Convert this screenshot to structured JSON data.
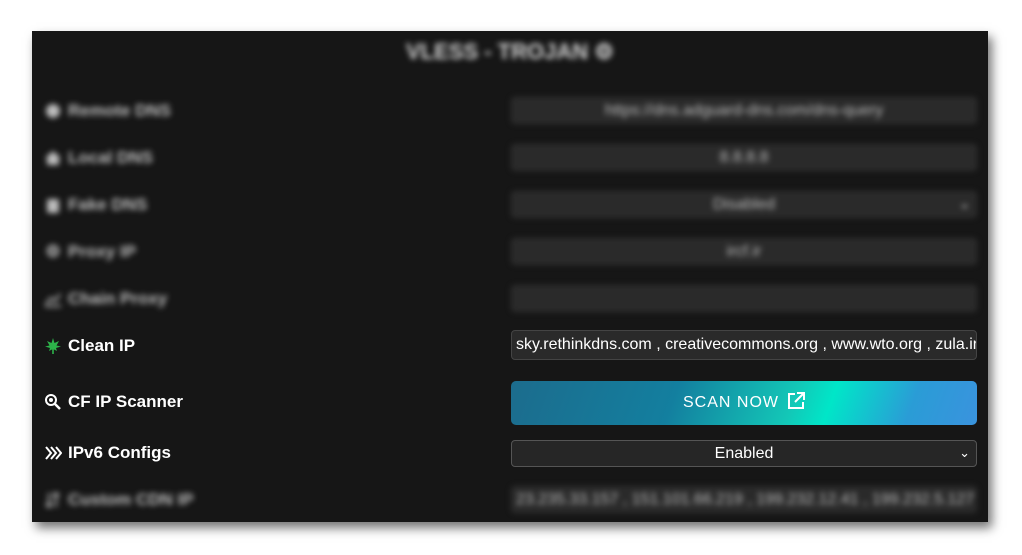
{
  "title": "VLESS - TROJAN",
  "rows": [
    {
      "label": "Remote DNS",
      "value": "https://dns.adguard-dns.com/dns-query"
    },
    {
      "label": "Local DNS",
      "value": "8.8.8.8"
    },
    {
      "label": "Fake DNS",
      "value": "Disabled"
    },
    {
      "label": "Proxy IP",
      "value": "ircf.ir"
    },
    {
      "label": "Chain Proxy",
      "value": ""
    },
    {
      "label": "Clean IP",
      "value": "sky.rethinkdns.com , creativecommons.org , www.wto.org , zula.ir"
    },
    {
      "label": "CF IP Scanner",
      "value": "SCAN NOW"
    },
    {
      "label": "IPv6 Configs",
      "value": "Enabled"
    },
    {
      "label": "Custom CDN IP",
      "value": "23.235.33.157 , 151.101.66.219 , 199.232.12.41 , 199.232.5.127"
    }
  ],
  "icons": {
    "title": "gear-icon",
    "remote_dns": "globe-icon",
    "local_dns": "home-icon",
    "fake_dns": "clipboard-icon",
    "proxy_ip": "gear-icon",
    "chain_proxy": "chart-icon",
    "clean_ip": "leaf-icon",
    "cf_ip_scanner": "magnifier-icon",
    "ipv6": "diamonds-icon",
    "custom_cdn_ip": "sort-icon",
    "scan_now": "external-link-icon"
  },
  "colors": {
    "panel_bg": "#161616",
    "field_bg": "#2a2a2a",
    "leaf_green": "#2db34a",
    "scan_gradient_start": "#1c6c8d",
    "scan_gradient_mid": "#00e6c8",
    "scan_gradient_end": "#3a93de"
  }
}
